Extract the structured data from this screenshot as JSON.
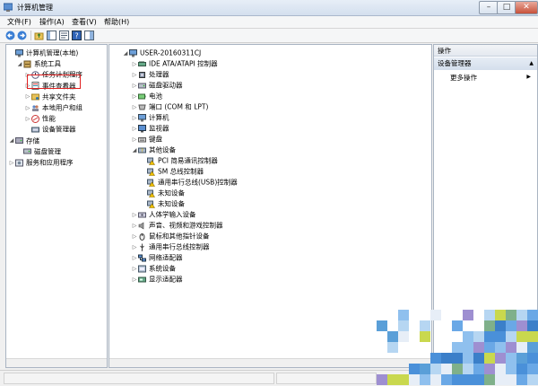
{
  "window": {
    "title": "计算机管理"
  },
  "menu": [
    "文件(F)",
    "操作(A)",
    "查看(V)",
    "帮助(H)"
  ],
  "left_tree": [
    {
      "label": "计算机管理(本地)",
      "depth": 0,
      "arrow": "",
      "icon": "computer-management-icon"
    },
    {
      "label": "系统工具",
      "depth": 1,
      "arrow": "◢",
      "icon": "system-tools-icon"
    },
    {
      "label": "任务计划程序",
      "depth": 2,
      "arrow": "▷",
      "icon": "task-scheduler-icon"
    },
    {
      "label": "事件查看器",
      "depth": 2,
      "arrow": "▷",
      "icon": "event-viewer-icon"
    },
    {
      "label": "共享文件夹",
      "depth": 2,
      "arrow": "▷",
      "icon": "shared-folders-icon"
    },
    {
      "label": "本地用户和组",
      "depth": 2,
      "arrow": "▷",
      "icon": "local-users-icon"
    },
    {
      "label": "性能",
      "depth": 2,
      "arrow": "▷",
      "icon": "performance-icon"
    },
    {
      "label": "设备管理器",
      "depth": 2,
      "arrow": "",
      "icon": "device-manager-icon"
    },
    {
      "label": "存储",
      "depth": 0,
      "arrow": "◢",
      "icon": "storage-icon"
    },
    {
      "label": "磁盘管理",
      "depth": 1,
      "arrow": "",
      "icon": "disk-management-icon"
    },
    {
      "label": "服务和应用程序",
      "depth": 0,
      "arrow": "▷",
      "icon": "services-icon"
    }
  ],
  "device_tree": [
    {
      "label": "USER-20160311CJ",
      "depth": 0,
      "arrow": "◢",
      "icon": "computer-icon"
    },
    {
      "label": "IDE ATA/ATAPI 控制器",
      "depth": 1,
      "arrow": "▷",
      "icon": "ide-controller-icon"
    },
    {
      "label": "处理器",
      "depth": 1,
      "arrow": "▷",
      "icon": "processor-icon"
    },
    {
      "label": "磁盘驱动器",
      "depth": 1,
      "arrow": "▷",
      "icon": "disk-drive-icon"
    },
    {
      "label": "电池",
      "depth": 1,
      "arrow": "▷",
      "icon": "battery-icon"
    },
    {
      "label": "端口 (COM 和 LPT)",
      "depth": 1,
      "arrow": "▷",
      "icon": "port-icon"
    },
    {
      "label": "计算机",
      "depth": 1,
      "arrow": "▷",
      "icon": "computer-icon"
    },
    {
      "label": "监视器",
      "depth": 1,
      "arrow": "▷",
      "icon": "monitor-icon"
    },
    {
      "label": "键盘",
      "depth": 1,
      "arrow": "▷",
      "icon": "keyboard-icon"
    },
    {
      "label": "其他设备",
      "depth": 1,
      "arrow": "◢",
      "icon": "other-devices-icon"
    },
    {
      "label": "PCI 简易通讯控制器",
      "depth": 2,
      "arrow": "",
      "icon": "unknown-device-icon"
    },
    {
      "label": "SM 总线控制器",
      "depth": 2,
      "arrow": "",
      "icon": "unknown-device-icon"
    },
    {
      "label": "通用串行总线(USB)控制器",
      "depth": 2,
      "arrow": "",
      "icon": "unknown-device-icon"
    },
    {
      "label": "未知设备",
      "depth": 2,
      "arrow": "",
      "icon": "unknown-device-icon"
    },
    {
      "label": "未知设备",
      "depth": 2,
      "arrow": "",
      "icon": "unknown-device-icon"
    },
    {
      "label": "人体学输入设备",
      "depth": 1,
      "arrow": "▷",
      "icon": "hid-icon"
    },
    {
      "label": "声音、视频和游戏控制器",
      "depth": 1,
      "arrow": "▷",
      "icon": "sound-icon"
    },
    {
      "label": "鼠标和其他指针设备",
      "depth": 1,
      "arrow": "▷",
      "icon": "mouse-icon"
    },
    {
      "label": "通用串行总线控制器",
      "depth": 1,
      "arrow": "▷",
      "icon": "usb-icon"
    },
    {
      "label": "网络适配器",
      "depth": 1,
      "arrow": "▷",
      "icon": "network-icon"
    },
    {
      "label": "系统设备",
      "depth": 1,
      "arrow": "▷",
      "icon": "system-device-icon"
    },
    {
      "label": "显示适配器",
      "depth": 1,
      "arrow": "▷",
      "icon": "display-adapter-icon"
    }
  ],
  "actions": {
    "header": "操作",
    "section": "设备管理器",
    "more": "更多操作"
  },
  "colors": {
    "highlight": "#e02020",
    "warning": "#f2c200"
  }
}
